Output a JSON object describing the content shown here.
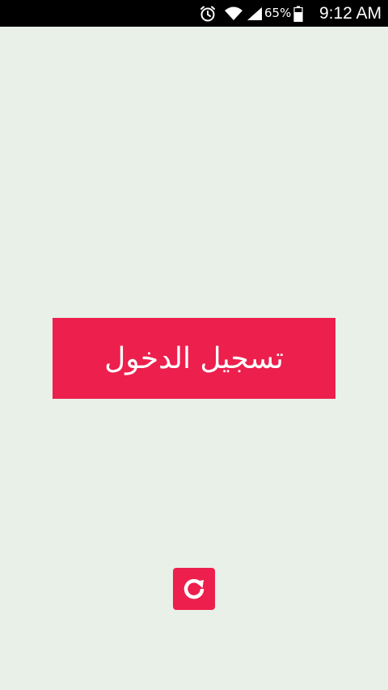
{
  "status_bar": {
    "battery_percent": "65%",
    "time": "9:12 AM",
    "icons": [
      "alarm-icon",
      "wifi-icon",
      "signal-icon",
      "battery-icon"
    ]
  },
  "main": {
    "login_label": "تسجيل الدخول",
    "refresh_icon": "refresh-icon"
  },
  "colors": {
    "accent": "#ec1f4d",
    "background": "#e8f0e8",
    "status_bar": "#000000"
  }
}
